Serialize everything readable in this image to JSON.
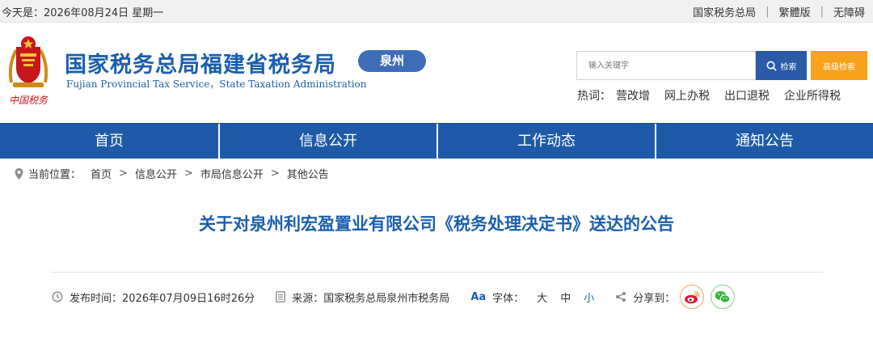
{
  "topbar": {
    "date_text": "今天是：2026年08月24日 星期一",
    "links": [
      "国家税务总局",
      "繁體版",
      "无障碍"
    ]
  },
  "header": {
    "site_title": "国家税务总局福建省税务局",
    "site_subtitle": "Fujian Provincial Tax Service，State Taxation Administration",
    "city_badge": "泉州",
    "emblem_caption": "中国税务",
    "search": {
      "placeholder": "输入关键字",
      "button_label": "检索",
      "advanced_label": "高级检索"
    },
    "hotwords_label": "热词：",
    "hotwords": [
      "营改增",
      "网上办税",
      "出口退税",
      "企业所得税"
    ]
  },
  "nav": {
    "items": [
      "首页",
      "信息公开",
      "工作动态",
      "通知公告"
    ]
  },
  "breadcrumb": {
    "label": "当前位置：",
    "items": [
      "首页",
      "信息公开",
      "市局信息公开",
      "其他公告"
    ]
  },
  "article": {
    "title": "关于对泉州利宏盈置业有限公司《税务处理决定书》送达的公告",
    "publish_label": "发布时间：",
    "publish_time": "2026年07月09日16时26分",
    "source_label": "来源：",
    "source": "国家税务总局泉州市税务局",
    "font_label": "字体：",
    "font_sizes": [
      "大",
      "中",
      "小"
    ],
    "share_label": "分享到："
  },
  "colors": {
    "brand_blue": "#1a5fae",
    "nav_blue": "#1e5aa8",
    "search_blue": "#2a5aa8",
    "advanced_orange": "#f7a21b",
    "emblem_red": "#c8161d"
  }
}
